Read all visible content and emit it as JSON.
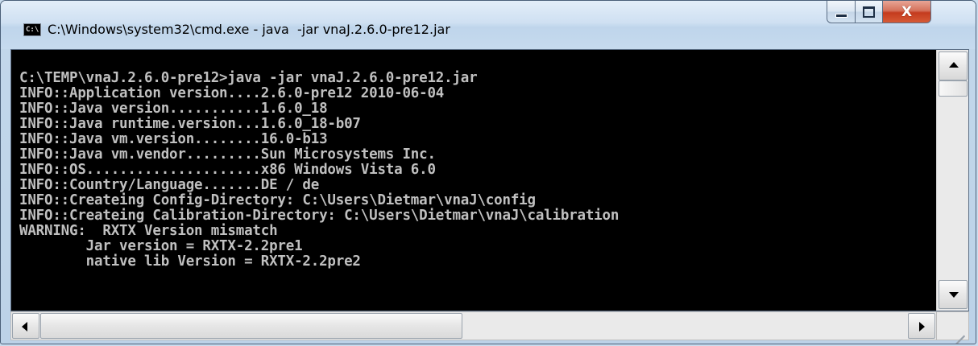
{
  "window": {
    "title": "C:\\Windows\\system32\\cmd.exe - java  -jar vnaJ.2.6.0-pre12.jar",
    "icon_label": "C:\\"
  },
  "caption_buttons": {
    "minimize_icon": "minimize-icon",
    "maximize_icon": "maximize-icon",
    "close_label": "X"
  },
  "console": {
    "text_color": "#c0c0c0",
    "background": "#000000",
    "lines": [
      "C:\\TEMP\\vnaJ.2.6.0-pre12>java -jar vnaJ.2.6.0-pre12.jar",
      "INFO::Application version....2.6.0-pre12 2010-06-04",
      "INFO::Java version...........1.6.0_18",
      "INFO::Java runtime.version...1.6.0_18-b07",
      "INFO::Java vm.version........16.0-b13",
      "INFO::Java vm.vendor.........Sun Microsystems Inc.",
      "INFO::OS.....................x86 Windows Vista 6.0",
      "INFO::Country/Language.......DE / de",
      "INFO::Createing Config-Directory: C:\\Users\\Dietmar\\vnaJ\\config",
      "INFO::Createing Calibration-Directory: C:\\Users\\Dietmar\\vnaJ\\calibration",
      "WARNING:  RXTX Version mismatch",
      "        Jar version = RXTX-2.2pre1",
      "        native lib Version = RXTX-2.2pre2"
    ]
  }
}
